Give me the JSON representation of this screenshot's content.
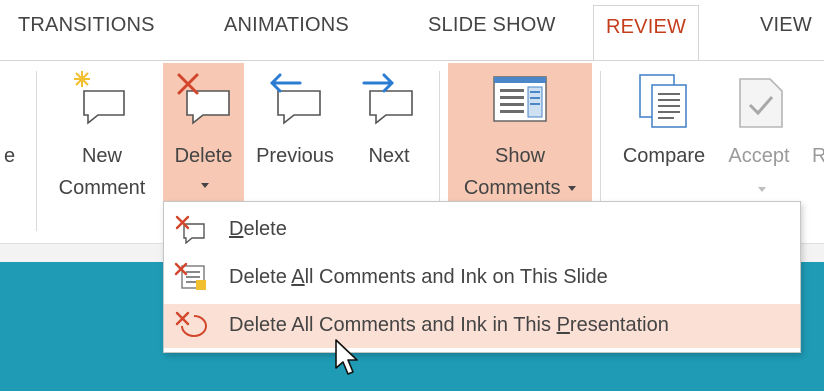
{
  "tabs": {
    "transitions": "TRANSITIONS",
    "animations": "ANIMATIONS",
    "slideshow": "SLIDE SHOW",
    "review": "REVIEW",
    "view": "VIEW"
  },
  "ribbon": {
    "cut_left": "e",
    "new_comment_line1": "New",
    "new_comment_line2": "Comment",
    "delete": "Delete",
    "previous": "Previous",
    "next": "Next",
    "show_line1": "Show",
    "show_line2": "Comments",
    "compare": "Compare",
    "accept": "Accept",
    "cut_right": "R"
  },
  "menu": {
    "items": [
      {
        "pre": "",
        "ul": "D",
        "post": "elete"
      },
      {
        "pre": "Delete ",
        "ul": "A",
        "post": "ll Comments and Ink on This Slide"
      },
      {
        "pre": "Delete All Comments and Ink in This ",
        "ul": "P",
        "post": "resentation"
      }
    ]
  },
  "colors": {
    "accent": "#c43e1c",
    "highlight": "#f7c9b4",
    "menu_hover": "#fbe1d5",
    "slide_bg": "#1f9bb5"
  },
  "icons": [
    "new-comment-icon",
    "delete-comment-icon",
    "previous-comment-icon",
    "next-comment-icon",
    "show-comments-icon",
    "compare-icon",
    "accept-icon",
    "delete-icon",
    "delete-slide-comments-icon",
    "delete-presentation-comments-icon",
    "mouse-pointer-icon"
  ]
}
